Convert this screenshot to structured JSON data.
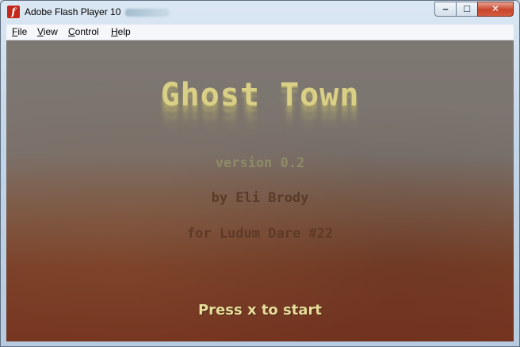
{
  "window": {
    "title": "Adobe Flash Player 10",
    "icon": "flash-player-icon",
    "controls": {
      "minimize": "minimize-icon",
      "maximize": "maximize-icon",
      "close": "close-icon"
    }
  },
  "menu": {
    "file": "File",
    "view": "View",
    "control": "Control",
    "help": "Help"
  },
  "game": {
    "title": "Ghost Town",
    "version": "version 0.2",
    "author": "by Eli Brody",
    "event": "for Ludum Dare #22",
    "prompt": "Press x to start"
  },
  "colors": {
    "title_yellow": "#d9cf86",
    "stage_top": "#7e7873",
    "stage_bottom": "#763420",
    "close_red": "#c7452b"
  }
}
